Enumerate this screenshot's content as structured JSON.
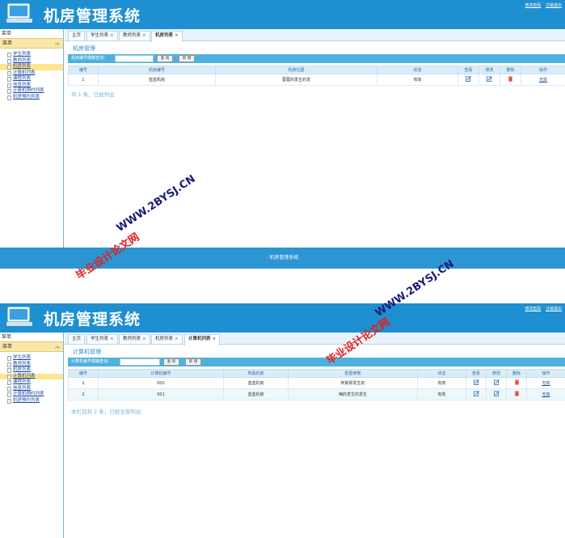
{
  "app_title": "机房管理系统",
  "header_links": [
    "修改密码",
    "注销退出"
  ],
  "left_top": "菜单",
  "menu_head": "菜单",
  "menu_items": [
    "学生列表",
    "教师列表",
    "机房列表",
    "计算机列表",
    "课程列表",
    "信息列表",
    "计算机预约列表",
    "机房预约列表"
  ],
  "shotA": {
    "tabs": [
      {
        "label": "主页",
        "close": ""
      },
      {
        "label": "学生列表",
        "close": "×"
      },
      {
        "label": "教师列表",
        "close": "×"
      },
      {
        "label": "机房列表",
        "close": "×"
      }
    ],
    "section_title": "机房管理",
    "search_label": "机房编号模糊查询：",
    "search_btn": "查 询",
    "add_btn": "新 增",
    "columns": [
      "编号",
      "机房编号",
      "机房位置",
      "状态",
      "查看",
      "修改",
      "删除",
      "操作"
    ],
    "rows": [
      {
        "no": "1",
        "a": "蓝蓝机房",
        "b": "蓉蓉的发生的发",
        "status": "有效",
        "op": "无效"
      }
    ],
    "count_text": "共 1 条，已经列出"
  },
  "footer_text": "- 机房管理系统",
  "shotB": {
    "tabs": [
      {
        "label": "主页",
        "close": ""
      },
      {
        "label": "学生列表",
        "close": "×"
      },
      {
        "label": "教师列表",
        "close": "×"
      },
      {
        "label": "机房列表",
        "close": "×"
      },
      {
        "label": "计算机列表",
        "close": "×"
      }
    ],
    "section_title": "计算机管理",
    "search_label": "计算机编号模糊查询：",
    "search_btn": "查 询",
    "add_btn": "新 增",
    "columns": [
      "编号",
      "计算机编号",
      "所属机房",
      "配置参数",
      "状态",
      "查看",
      "修改",
      "删除",
      "操作"
    ],
    "rows": [
      {
        "no": "1",
        "a": "002",
        "b": "蓝蓝机房",
        "c": "阿斯顿发生的",
        "status": "有效",
        "op": "无效"
      },
      {
        "no": "2",
        "a": "001",
        "b": "蓝蓝机房",
        "c": "嗨的发生的发生",
        "status": "有效",
        "op": "无效"
      }
    ],
    "count_text": "本栏目共 2 条，已经全部列出"
  },
  "watermarks": {
    "site": "WWW.2BYSJ.CN",
    "cn": "毕业设计论文网"
  },
  "colors": {
    "header": "#1e8fd0",
    "active_menu": "#ffe58f",
    "delete_icon": "#e05030",
    "edit_icon": "#3a7fc0"
  }
}
